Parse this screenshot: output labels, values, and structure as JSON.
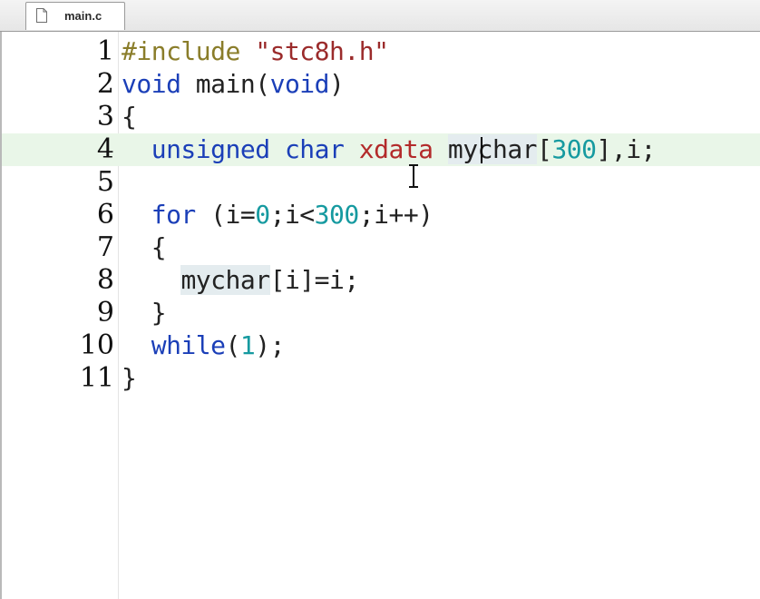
{
  "tab": {
    "label": "main.c",
    "icon": "file-icon"
  },
  "editor": {
    "current_line": 4,
    "lines": [
      {
        "num": "1",
        "parts": {
          "a": "#include ",
          "b": "\"stc8h.h\""
        }
      },
      {
        "num": "2",
        "parts": {
          "a": "void",
          "b": " main(",
          "c": "void",
          "d": ")"
        }
      },
      {
        "num": "3",
        "parts": {
          "a": "{"
        }
      },
      {
        "num": "4",
        "parts": {
          "a": "  ",
          "b": "unsigned",
          "c": " ",
          "d": "char",
          "e": " ",
          "f": "xdata",
          "g": " ",
          "h": "mychar",
          "i": "[",
          "j": "300",
          "k": "],i;"
        }
      },
      {
        "num": "5",
        "parts": {}
      },
      {
        "num": "6",
        "parts": {
          "a": "  ",
          "b": "for",
          "c": " (i=",
          "d": "0",
          "e": ";i<",
          "f": "300",
          "g": ";i++)"
        }
      },
      {
        "num": "7",
        "parts": {
          "a": "  {"
        }
      },
      {
        "num": "8",
        "parts": {
          "a": "    ",
          "b": "mychar",
          "c": "[i]=i;"
        }
      },
      {
        "num": "9",
        "parts": {
          "a": "  }"
        }
      },
      {
        "num": "10",
        "parts": {
          "a": "  ",
          "b": "while",
          "c": "(",
          "d": "1",
          "e": ");"
        }
      },
      {
        "num": "11",
        "parts": {
          "a": "}"
        }
      }
    ]
  },
  "colors": {
    "keyword": "#1b3fb8",
    "string": "#9b2b2b",
    "number": "#169aa0",
    "preprocessor": "#8a7d2a",
    "current_line_bg": "#e9f6e8"
  }
}
